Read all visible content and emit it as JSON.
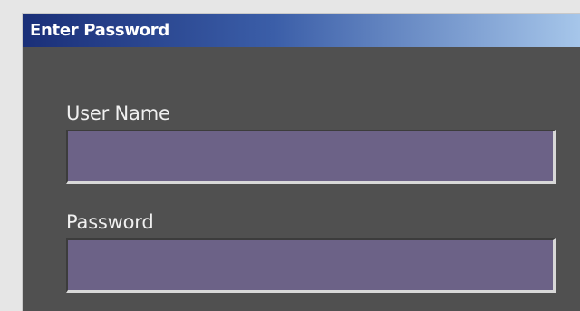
{
  "window": {
    "title": "Enter Password"
  },
  "form": {
    "username": {
      "label": "User Name",
      "value": ""
    },
    "password": {
      "label": "Password",
      "value": ""
    }
  },
  "colors": {
    "dialog_background": "#505050",
    "field_background": "#6c6287",
    "title_gradient_start": "#1a2f78",
    "title_gradient_end": "#a6c6ea",
    "label_text": "#f0f0f0"
  }
}
